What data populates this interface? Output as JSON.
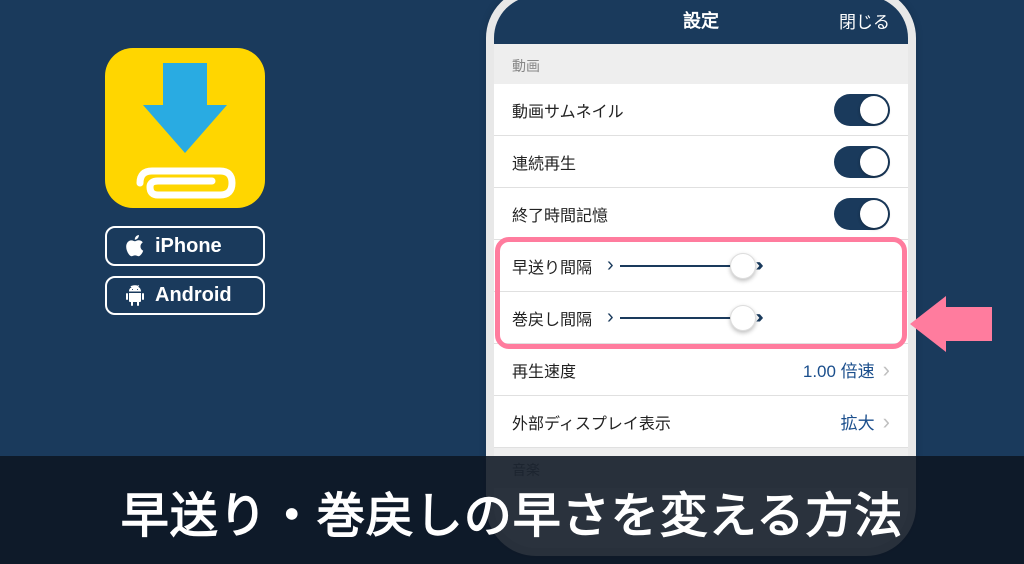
{
  "app_icon": {
    "tint": "#ffd600",
    "arrow_color": "#29abe2"
  },
  "badges": {
    "iphone": "iPhone",
    "android": "Android"
  },
  "phone": {
    "nav_title": "設定",
    "nav_close": "閉じる",
    "section_video": "動画",
    "section_audio": "音楽",
    "rows": {
      "thumbnail": "動画サムネイル",
      "continuous": "連続再生",
      "endtime": "終了時間記憶",
      "ff_interval": "早送り間隔",
      "rw_interval": "巻戻し間隔",
      "playback_speed_label": "再生速度",
      "playback_speed_value": "1.00 倍速",
      "ext_display_label": "外部ディスプレイ表示",
      "ext_display_value": "拡大"
    }
  },
  "banner": "早送り・巻戻しの早さを変える方法"
}
